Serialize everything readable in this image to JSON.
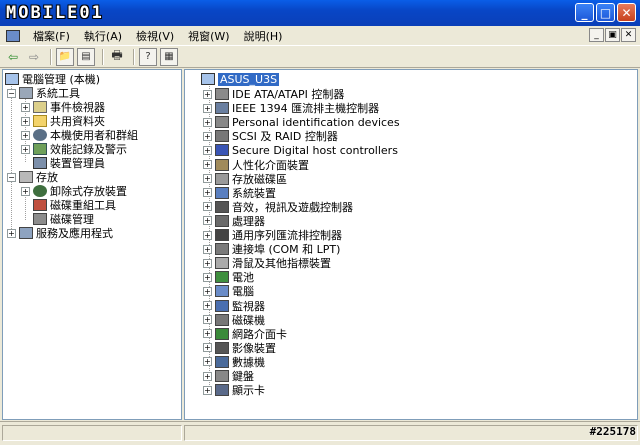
{
  "logo_text": "MOBILE01",
  "titlebar_buttons": [
    "_",
    "□",
    "✕"
  ],
  "menu": [
    "檔案(F)",
    "執行(A)",
    "檢視(V)",
    "視窗(W)",
    "說明(H)"
  ],
  "mdi_buttons": [
    "_",
    "▣",
    "✕"
  ],
  "tree": {
    "root": "電腦管理 (本機)",
    "groups": [
      {
        "label": "系統工具",
        "expanded": true,
        "children": [
          {
            "label": "事件檢視器",
            "has_children": true
          },
          {
            "label": "共用資料夾",
            "has_children": true
          },
          {
            "label": "本機使用者和群組",
            "has_children": true
          },
          {
            "label": "效能記錄及警示",
            "has_children": true
          },
          {
            "label": "裝置管理員",
            "has_children": false
          }
        ]
      },
      {
        "label": "存放",
        "expanded": true,
        "children": [
          {
            "label": "卸除式存放裝置",
            "has_children": true
          },
          {
            "label": "磁碟重組工具",
            "has_children": false
          },
          {
            "label": "磁碟管理",
            "has_children": false
          }
        ]
      },
      {
        "label": "服務及應用程式",
        "expanded": false,
        "children": []
      }
    ]
  },
  "devices": {
    "root": "ASUS_U3S",
    "items": [
      "IDE ATA/ATAPI 控制器",
      "IEEE 1394 匯流排主機控制器",
      "Personal identification devices",
      "SCSI 及 RAID 控制器",
      "Secure Digital host controllers",
      "人性化介面裝置",
      "存放磁碟區",
      "系統裝置",
      "音效，視訊及遊戲控制器",
      "處理器",
      "通用序列匯流排控制器",
      "連接埠 (COM 和 LPT)",
      "滑鼠及其他指標裝置",
      "電池",
      "電腦",
      "監視器",
      "磁碟機",
      "網路介面卡",
      "影像裝置",
      "數據機",
      "鍵盤",
      "顯示卡"
    ]
  },
  "watermark": "#225178"
}
